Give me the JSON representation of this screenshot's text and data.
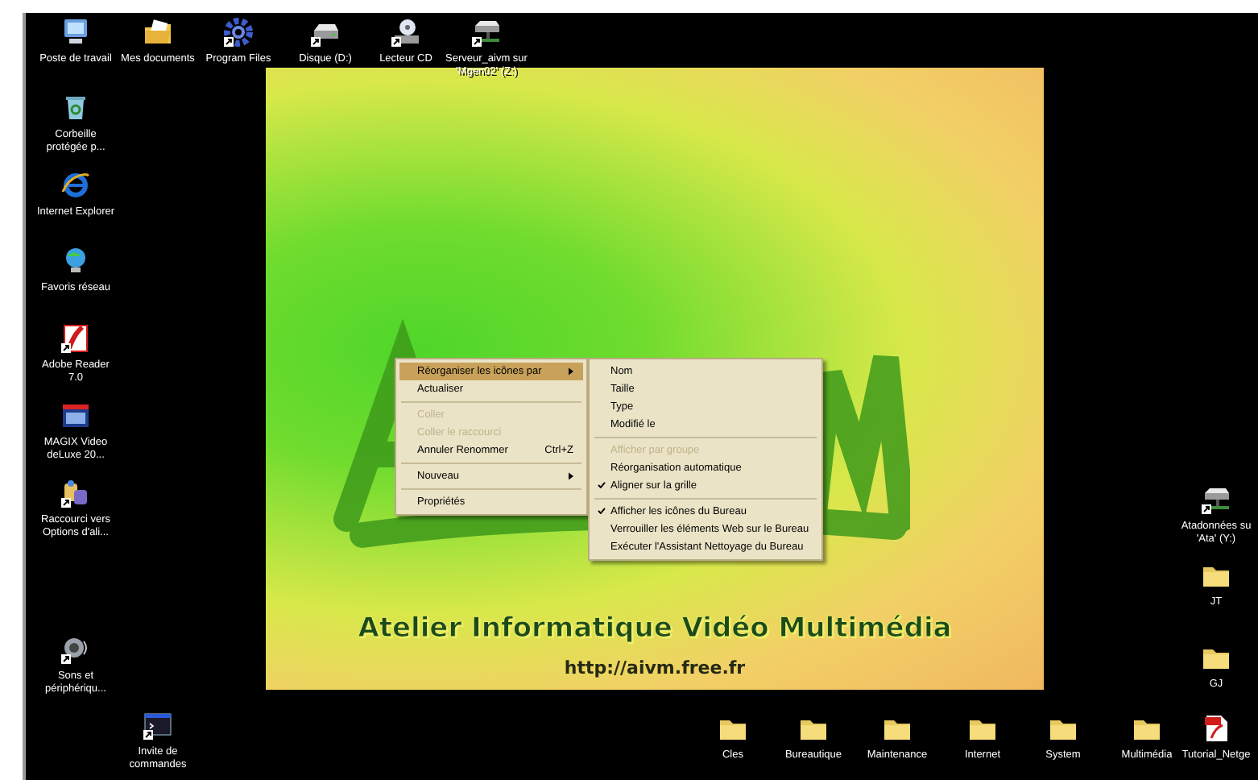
{
  "top_row": [
    {
      "label": "Poste de travail",
      "kind": "computer",
      "shortcut": false
    },
    {
      "label": "Mes documents",
      "kind": "documents",
      "shortcut": false
    },
    {
      "label": "Program Files",
      "kind": "gear",
      "shortcut": true
    },
    {
      "label": "Disque (D:)",
      "kind": "drive",
      "shortcut": true
    },
    {
      "label": "Lecteur CD",
      "kind": "cd",
      "shortcut": true
    },
    {
      "label": "Serveur_aivm sur 'Mgen02' (Z:)",
      "kind": "netdrive",
      "shortcut": true
    }
  ],
  "left_column": [
    {
      "label": "Corbeille protégée p...",
      "kind": "recycle",
      "shortcut": false
    },
    {
      "label": "Internet Explorer",
      "kind": "browser",
      "shortcut": false
    },
    {
      "label": "Favoris réseau",
      "kind": "network",
      "shortcut": false
    },
    {
      "label": "Adobe Reader 7.0",
      "kind": "reader",
      "shortcut": true
    },
    {
      "label": "MAGIX Video deLuxe 20...",
      "kind": "video",
      "shortcut": false
    },
    {
      "label": "Raccourci vers Options d'ali...",
      "kind": "power",
      "shortcut": true
    },
    {
      "label": "Sons et périphériqu...",
      "kind": "speaker",
      "shortcut": true
    }
  ],
  "command_prompt": {
    "label": "Invite de commandes",
    "kind": "console",
    "shortcut": true
  },
  "right_column": [
    {
      "label": "Atadonnées su 'Ata' (Y:)",
      "kind": "netdrive",
      "shortcut": true
    },
    {
      "label": "JT",
      "kind": "folder",
      "shortcut": false
    },
    {
      "label": "GJ",
      "kind": "folder",
      "shortcut": false
    }
  ],
  "bottom_row": [
    {
      "label": "Cles",
      "kind": "folder",
      "shortcut": false
    },
    {
      "label": "Bureautique",
      "kind": "folder",
      "shortcut": false
    },
    {
      "label": "Maintenance",
      "kind": "folder",
      "shortcut": false
    },
    {
      "label": "Internet",
      "kind": "folder",
      "shortcut": false
    },
    {
      "label": "System",
      "kind": "folder",
      "shortcut": false
    },
    {
      "label": "Multimédia",
      "kind": "folder",
      "shortcut": false
    },
    {
      "label": "Tutorial_Netge",
      "kind": "pdf",
      "shortcut": false
    }
  ],
  "wallpaper": {
    "title": "Atelier Informatique Vidéo Multimédia",
    "url": "http://aivm.free.fr"
  },
  "context_menu": {
    "items": [
      {
        "kind": "item",
        "label": "Réorganiser les icônes par",
        "selected": true,
        "disabled": false,
        "submenu": true
      },
      {
        "kind": "item",
        "label": "Actualiser",
        "selected": false,
        "disabled": false,
        "submenu": false
      },
      {
        "kind": "separator"
      },
      {
        "kind": "item",
        "label": "Coller",
        "selected": false,
        "disabled": true,
        "submenu": false
      },
      {
        "kind": "item",
        "label": "Coller le raccourci",
        "selected": false,
        "disabled": true,
        "submenu": false
      },
      {
        "kind": "item",
        "label": "Annuler Renommer",
        "shortcut": "Ctrl+Z",
        "selected": false,
        "disabled": false,
        "submenu": false
      },
      {
        "kind": "separator"
      },
      {
        "kind": "item",
        "label": "Nouveau",
        "selected": false,
        "disabled": false,
        "submenu": true
      },
      {
        "kind": "separator"
      },
      {
        "kind": "item",
        "label": "Propriétés",
        "selected": false,
        "disabled": false,
        "submenu": false
      }
    ]
  },
  "submenu": {
    "items": [
      {
        "kind": "item",
        "label": "Nom",
        "checked": false,
        "disabled": false
      },
      {
        "kind": "item",
        "label": "Taille",
        "checked": false,
        "disabled": false
      },
      {
        "kind": "item",
        "label": "Type",
        "checked": false,
        "disabled": false
      },
      {
        "kind": "item",
        "label": "Modifié le",
        "checked": false,
        "disabled": false
      },
      {
        "kind": "separator"
      },
      {
        "kind": "item",
        "label": "Afficher par groupe",
        "checked": false,
        "disabled": true
      },
      {
        "kind": "item",
        "label": "Réorganisation automatique",
        "checked": false,
        "disabled": false
      },
      {
        "kind": "item",
        "label": "Aligner sur la grille",
        "checked": true,
        "disabled": false
      },
      {
        "kind": "separator"
      },
      {
        "kind": "item",
        "label": "Afficher les icônes du Bureau",
        "checked": true,
        "disabled": false
      },
      {
        "kind": "item",
        "label": "Verrouiller les éléments Web sur le Bureau",
        "checked": false,
        "disabled": false
      },
      {
        "kind": "item",
        "label": "Exécuter l'Assistant Nettoyage du Bureau",
        "checked": false,
        "disabled": false
      }
    ]
  }
}
